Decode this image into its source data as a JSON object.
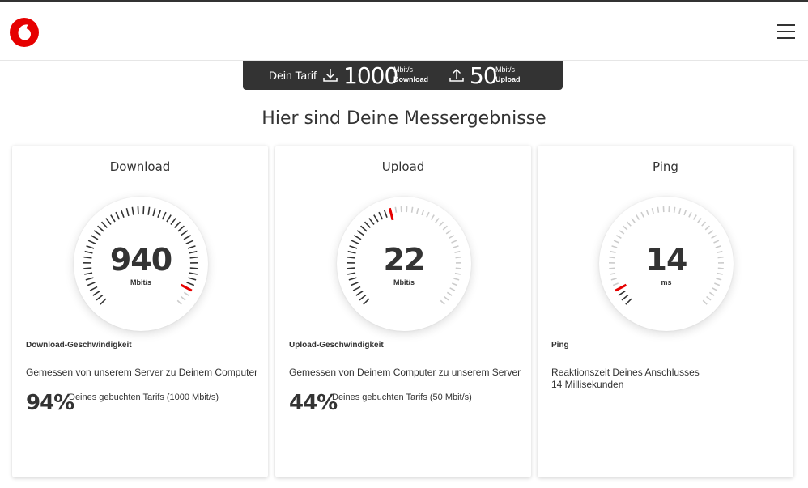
{
  "brand": {
    "accent": "#e60000",
    "dark": "#333333"
  },
  "header": {
    "logo_icon": "vodafone-logo-icon",
    "menu_icon": "hamburger-menu-icon"
  },
  "tarif": {
    "label": "Dein Tarif",
    "download_value": "1000",
    "download_unit": "Mbit/s",
    "download_label": "Download",
    "upload_value": "50",
    "upload_unit": "Mbit/s",
    "upload_label": "Upload"
  },
  "page_title": "Hier sind Deine Messergebnisse",
  "cards": [
    {
      "title": "Download",
      "value": "940",
      "unit": "Mbit/s",
      "fraction": 0.94,
      "heading": "Download-Geschwindigkeit",
      "description": "Gemessen von unserem Server zu Deinem Computer",
      "percent": "94%",
      "percent_note": "Deines gebuchten Tarifs (1000 Mbit/s)"
    },
    {
      "title": "Upload",
      "value": "22",
      "unit": "Mbit/s",
      "fraction": 0.44,
      "heading": "Upload-Geschwindigkeit",
      "description": "Gemessen von Deinem Computer zu unserem Server",
      "percent": "44%",
      "percent_note": "Deines gebuchten Tarifs (50 Mbit/s)"
    },
    {
      "title": "Ping",
      "value": "14",
      "unit": "ms",
      "fraction": 0.07,
      "heading": "Ping",
      "description": "Reaktionszeit Deines Anschlusses",
      "description2": "14 Millisekunden"
    }
  ]
}
